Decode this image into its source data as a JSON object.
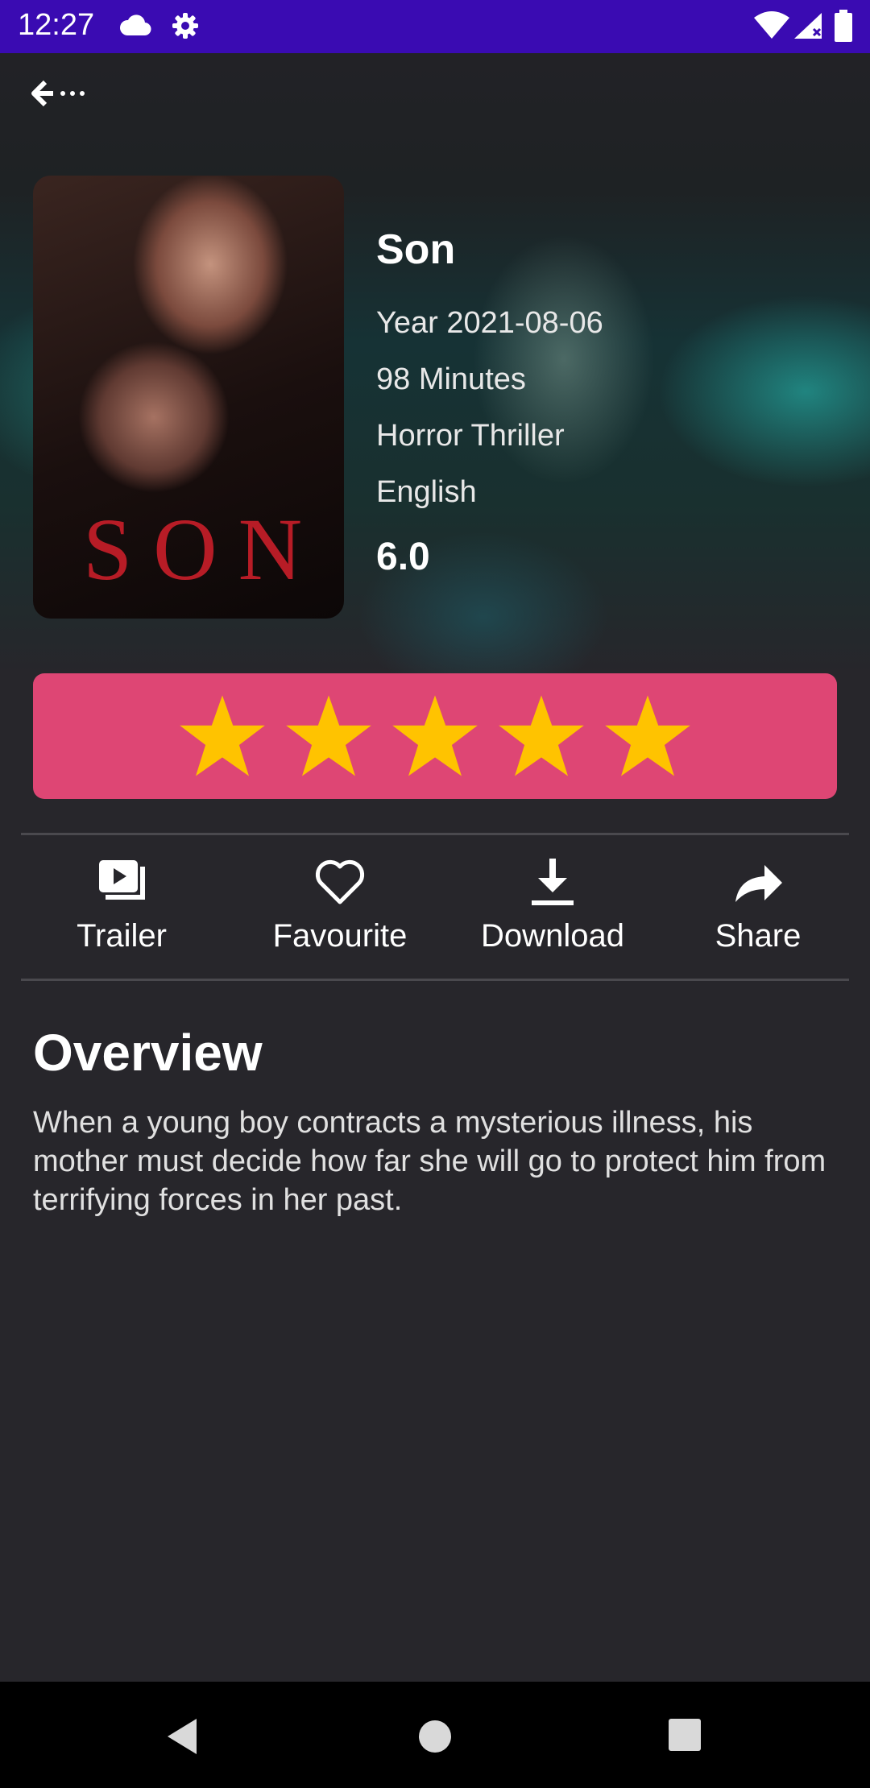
{
  "status_bar": {
    "time": "12:27"
  },
  "movie": {
    "title": "Son",
    "year": "Year 2021-08-06",
    "runtime": "98 Minutes",
    "genres": "Horror Thriller",
    "language": "English",
    "rating": "6.0",
    "poster_title": "SON"
  },
  "rating_bar": {
    "stars_filled": 5,
    "stars_total": 5,
    "background_color": "#de4674",
    "star_color": "#ffc300"
  },
  "actions": {
    "trailer": "Trailer",
    "favourite": "Favourite",
    "download": "Download",
    "share": "Share"
  },
  "overview": {
    "heading": "Overview",
    "text": "When a young boy contracts a mysterious illness, his mother must decide how far she will go to protect him from terrifying forces in her past."
  },
  "colors": {
    "status_bar": "#3a0bb2",
    "background": "#27262b"
  },
  "icons": [
    "cloud-icon",
    "gear-icon",
    "wifi-icon",
    "signal-icon",
    "battery-icon",
    "back-arrow-icon",
    "trailer-icon",
    "heart-icon",
    "download-icon",
    "share-icon",
    "nav-back-icon",
    "nav-home-icon",
    "nav-recents-icon"
  ]
}
